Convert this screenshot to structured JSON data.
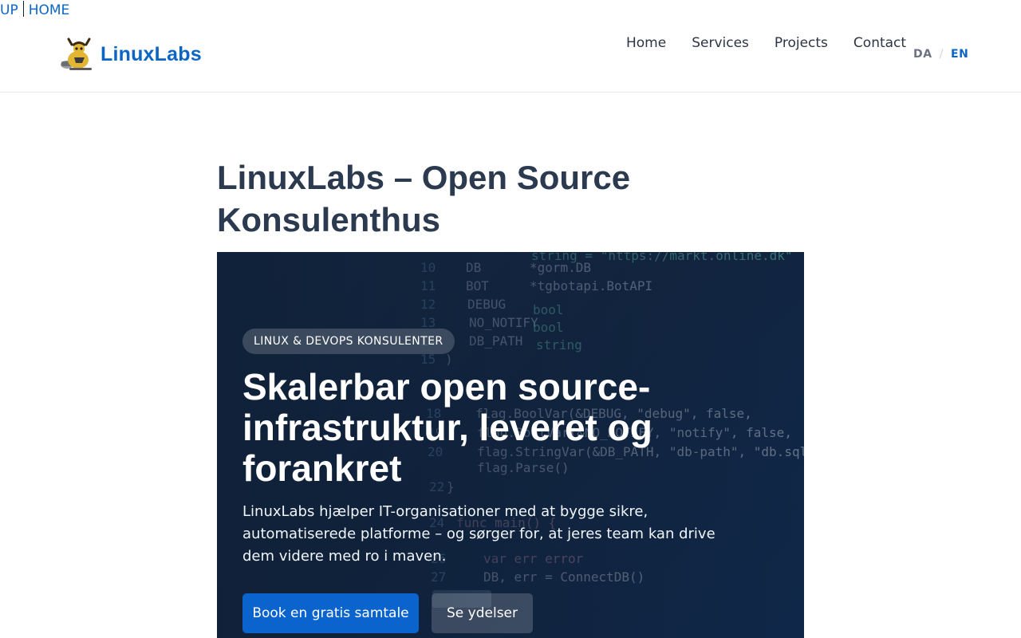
{
  "topbar": {
    "up_label": "UP",
    "home_label": "HOME"
  },
  "header": {
    "brand_name": "LinuxLabs",
    "nav": [
      {
        "label": "Home"
      },
      {
        "label": "Services"
      },
      {
        "label": "Projects"
      },
      {
        "label": "Contact"
      }
    ],
    "language": {
      "da": "DA",
      "separator": "/",
      "en": "EN",
      "active": "EN"
    }
  },
  "main": {
    "page_title": "LinuxLabs – Open Source Konsulenthus",
    "hero": {
      "badge": "LINUX & DEVOPS KONSULENTER",
      "heading": "Skalerbar open source-infrastruktur, leveret og forankret",
      "text": "LinuxLabs hjælper IT-organisationer med at bygge sikre, automatiserede platforme – og sørger for, at jeres team kan drive dem videre med ro i maven.",
      "primary_button": "Book en gratis samtale",
      "secondary_button": "Se ydelser"
    }
  },
  "colors": {
    "accent": "#0b66c3",
    "hero_background": "#132641",
    "title_text": "#2b3a4e"
  }
}
